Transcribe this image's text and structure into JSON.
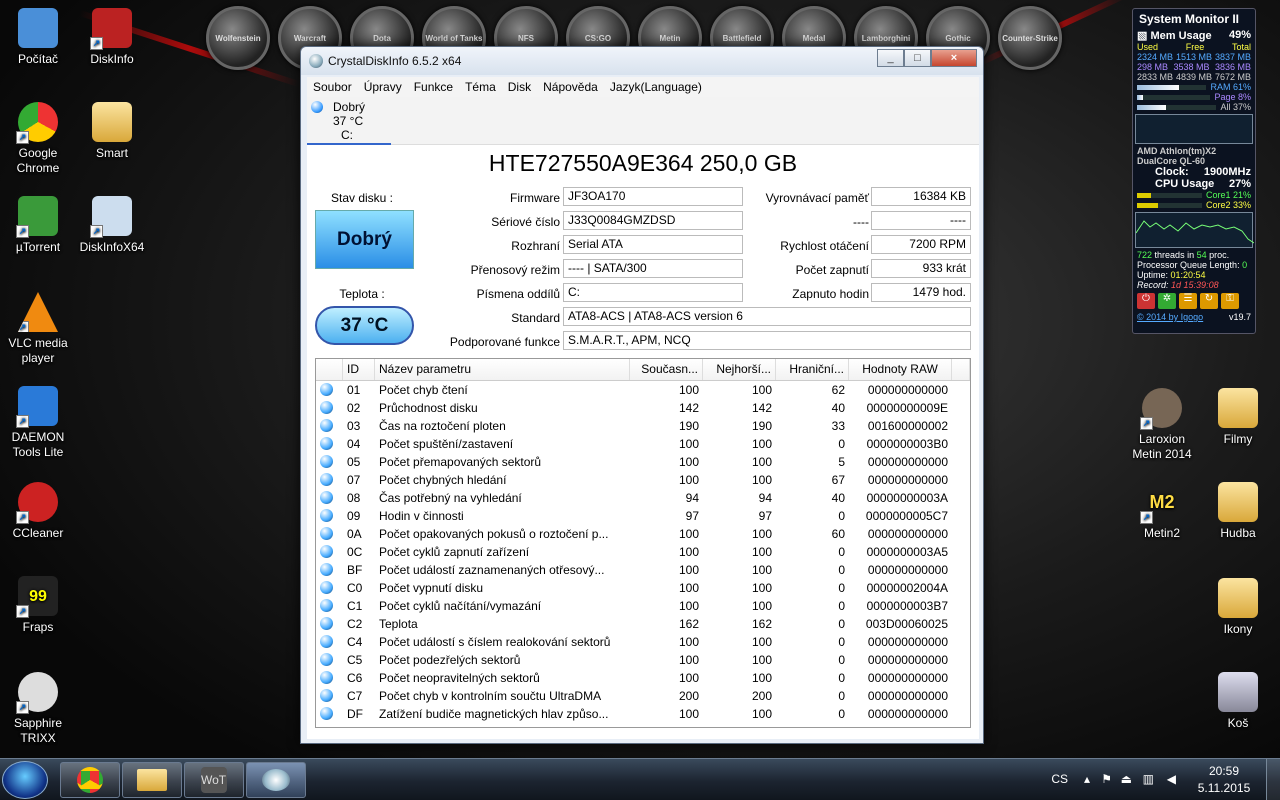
{
  "desktop": {
    "left_icons": [
      {
        "label": "Počítač",
        "icon": "computer-icon"
      },
      {
        "label": "Google Chrome",
        "icon": "chrome-icon"
      },
      {
        "label": "µTorrent",
        "icon": "utorrent-icon"
      },
      {
        "label": "VLC media player",
        "icon": "vlc-icon"
      },
      {
        "label": "DAEMON Tools Lite",
        "icon": "daemon-tools-icon"
      },
      {
        "label": "CCleaner",
        "icon": "ccleaner-icon"
      },
      {
        "label": "Fraps",
        "icon": "fraps-icon"
      },
      {
        "label": "Sapphire TRIXX",
        "icon": "trixx-icon"
      }
    ],
    "col2_icons": [
      {
        "label": "DiskInfo",
        "icon": "diskinfo-icon"
      },
      {
        "label": "Smart",
        "icon": "folder-icon"
      },
      {
        "label": "DiskInfoX64",
        "icon": "diskinfox64-icon"
      }
    ],
    "right_icons": [
      {
        "label": "Laroxion Metin 2014",
        "icon": "laroxion-icon"
      },
      {
        "label": "Filmy",
        "icon": "folder-icon"
      },
      {
        "label": "Metin2",
        "icon": "metin2-icon"
      },
      {
        "label": "Hudba",
        "icon": "folder-icon"
      },
      {
        "label": "Ikony",
        "icon": "folder-icon"
      },
      {
        "label": "Koš",
        "icon": "recycle-bin-icon"
      }
    ],
    "game_strip": [
      "Wolfenstein",
      "Warcraft",
      "Dota",
      "World of Tanks",
      "NFS",
      "CS:GO",
      "Metin",
      "Battlefield",
      "Medal",
      "Lamborghini",
      "Gothic",
      "Counter-Strike"
    ]
  },
  "window": {
    "title": "CrystalDiskInfo 6.5.2 x64",
    "buttons": [
      "_",
      "□",
      "×"
    ],
    "menu": [
      "Soubor",
      "Úpravy",
      "Funkce",
      "Téma",
      "Disk",
      "Nápověda",
      "Jazyk(Language)"
    ],
    "disk_tab": {
      "status": "Dobrý",
      "temp": "37 °C",
      "letter": "C:"
    },
    "model": "HTE727550A9E364 250,0 GB",
    "health_label": "Stav disku :",
    "health_value": "Dobrý",
    "temp_label": "Teplota :",
    "temp_value": "37 °C",
    "fields": {
      "firmware": {
        "label": "Firmware",
        "value": "JF3OA170"
      },
      "serial": {
        "label": "Sériové číslo",
        "value": "J33Q0084GMZDSD"
      },
      "interface": {
        "label": "Rozhraní",
        "value": "Serial ATA"
      },
      "transfer": {
        "label": "Přenosový režim",
        "value": "---- | SATA/300"
      },
      "letters": {
        "label": "Písmena oddílů",
        "value": "C:"
      },
      "standard": {
        "label": "Standard",
        "value": "ATA8-ACS | ATA8-ACS version 6"
      },
      "features": {
        "label": "Podporované funkce",
        "value": "S.M.A.R.T., APM, NCQ"
      },
      "buffer": {
        "label": "Vyrovnávací paměť",
        "value": "16384 KB"
      },
      "blank": {
        "label": "----",
        "value": "----"
      },
      "rpm": {
        "label": "Rychlost otáčení",
        "value": "7200 RPM"
      },
      "power_count": {
        "label": "Počet zapnutí",
        "value": "933 krát"
      },
      "power_hours": {
        "label": "Zapnuto hodin",
        "value": "1479 hod."
      }
    },
    "table": {
      "headers": [
        "",
        "ID",
        "Název parametru",
        "Současn...",
        "Nejhorší...",
        "Hraniční...",
        "Hodnoty RAW"
      ],
      "rows": [
        [
          "01",
          "Počet chyb čtení",
          "100",
          "100",
          "62",
          "000000000000"
        ],
        [
          "02",
          "Průchodnost disku",
          "142",
          "142",
          "40",
          "00000000009E"
        ],
        [
          "03",
          "Čas na roztočení ploten",
          "190",
          "190",
          "33",
          "001600000002"
        ],
        [
          "04",
          "Počet spuštění/zastavení",
          "100",
          "100",
          "0",
          "0000000003B0"
        ],
        [
          "05",
          "Počet přemapovaných sektorů",
          "100",
          "100",
          "5",
          "000000000000"
        ],
        [
          "07",
          "Počet chybných hledání",
          "100",
          "100",
          "67",
          "000000000000"
        ],
        [
          "08",
          "Čas potřebný na vyhledání",
          "94",
          "94",
          "40",
          "00000000003A"
        ],
        [
          "09",
          "Hodin v činnosti",
          "97",
          "97",
          "0",
          "0000000005C7"
        ],
        [
          "0A",
          "Počet opakovaných pokusů o roztočení p...",
          "100",
          "100",
          "60",
          "000000000000"
        ],
        [
          "0C",
          "Počet cyklů zapnutí zařízení",
          "100",
          "100",
          "0",
          "0000000003A5"
        ],
        [
          "BF",
          "Počet událostí zaznamenaných otřesový...",
          "100",
          "100",
          "0",
          "000000000000"
        ],
        [
          "C0",
          "Počet vypnutí disku",
          "100",
          "100",
          "0",
          "00000002004A"
        ],
        [
          "C1",
          "Počet cyklů načítání/vymazání",
          "100",
          "100",
          "0",
          "0000000003B7"
        ],
        [
          "C2",
          "Teplota",
          "162",
          "162",
          "0",
          "003D00060025"
        ],
        [
          "C4",
          "Počet událostí s číslem realokování sektorů",
          "100",
          "100",
          "0",
          "000000000000"
        ],
        [
          "C5",
          "Počet podezřelých sektorů",
          "100",
          "100",
          "0",
          "000000000000"
        ],
        [
          "C6",
          "Počet neopravitelných sektorů",
          "100",
          "100",
          "0",
          "000000000000"
        ],
        [
          "C7",
          "Počet chyb v kontrolním součtu UltraDMA",
          "200",
          "200",
          "0",
          "000000000000"
        ],
        [
          "DF",
          "Zatížení budiče magnetických hlav způso...",
          "100",
          "100",
          "0",
          "000000000000"
        ]
      ]
    }
  },
  "sysmon": {
    "title": "System Monitor II",
    "mem_label": "Mem Usage",
    "mem_pct": "49%",
    "cols": [
      "Used",
      "Free",
      "Total"
    ],
    "r1": [
      "2324 MB",
      "1513 MB",
      "3837 MB"
    ],
    "r2": [
      "298 MB",
      "3538 MB",
      "3836 MB"
    ],
    "r3": [
      "2833 MB",
      "4839 MB",
      "7672 MB"
    ],
    "ram": "RAM",
    "ram_pct": "61%",
    "ram_level": 0.61,
    "page": "Page",
    "page_pct": "8%",
    "page_level": 0.08,
    "all": "All",
    "all_pct": "37%",
    "all_level": 0.37,
    "cpu_name1": "AMD Athlon(tm)X2",
    "cpu_name2": "DualCore QL-60",
    "clock_label": "Clock:",
    "clock": "1900MHz",
    "cpu_label": "CPU Usage",
    "cpu_pct": "27%",
    "core1": "Core1",
    "core1_pct": "21%",
    "core1_level": 0.21,
    "core2": "Core2",
    "core2_pct": "33%",
    "core2_level": 0.33,
    "threads": "722",
    "threads_txt": "threads in",
    "procs": "54",
    "procs_txt": "proc.",
    "pql": "Processor Queue Length:",
    "pql_val": "0",
    "uptime_label": "Uptime:",
    "uptime": "01:20:54",
    "record_label": "Record:",
    "record": "1d 15:39:08",
    "copyright": "© 2014 by Igogo",
    "version": "v19.7"
  },
  "taskbar": {
    "lang": "CS",
    "time": "20:59",
    "date": "5.11.2015"
  }
}
